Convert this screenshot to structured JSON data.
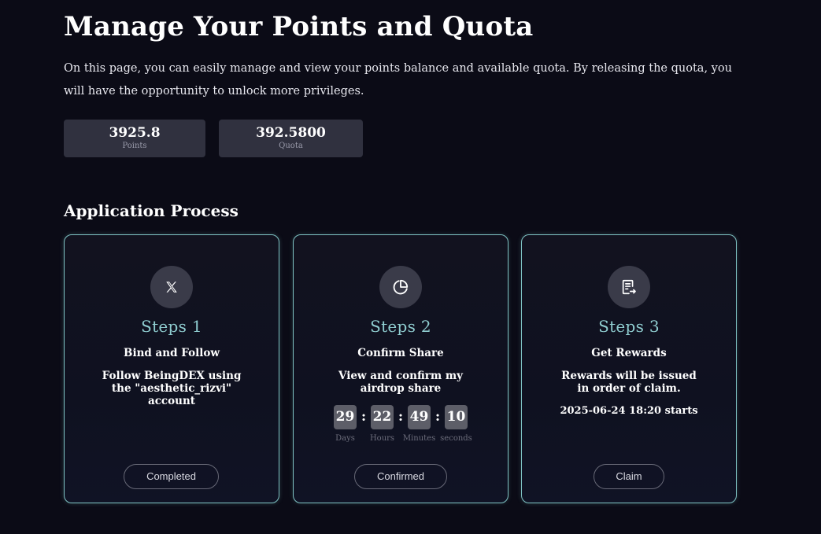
{
  "header": {
    "title": "Manage Your Points and Quota",
    "intro": "On this page, you can easily manage and view your points balance and available quota. By releasing the quota, you will have the opportunity to unlock more privileges."
  },
  "stats": {
    "points": {
      "value": "3925.8",
      "label": "Points"
    },
    "quota": {
      "value": "392.5800",
      "label": "Quota"
    }
  },
  "process": {
    "title": "Application Process",
    "steps": [
      {
        "icon": "x-logo-icon",
        "number": "Steps 1",
        "title": "Bind and Follow",
        "description": "Follow BeingDEX using the \"aesthetic_rizvi\" account",
        "button": "Completed"
      },
      {
        "icon": "pie-chart-icon",
        "number": "Steps 2",
        "title": "Confirm Share",
        "description": "View and confirm my airdrop share",
        "countdown": [
          {
            "value": "29",
            "label": "Days"
          },
          {
            "value": "22",
            "label": "Hours"
          },
          {
            "value": "49",
            "label": "Minutes"
          },
          {
            "value": "10",
            "label": "seconds"
          }
        ],
        "separator": ":",
        "button": "Confirmed"
      },
      {
        "icon": "document-export-icon",
        "number": "Steps 3",
        "title": "Get Rewards",
        "description": "Rewards will be issued in order of claim.",
        "start_time": "2025-06-24 18:20 starts",
        "button": "Claim"
      }
    ]
  },
  "colors": {
    "background": "#0b0b16",
    "accent": "#8fcdd0",
    "card_border": "#7fc3c4",
    "stat_box": "#30313f"
  }
}
